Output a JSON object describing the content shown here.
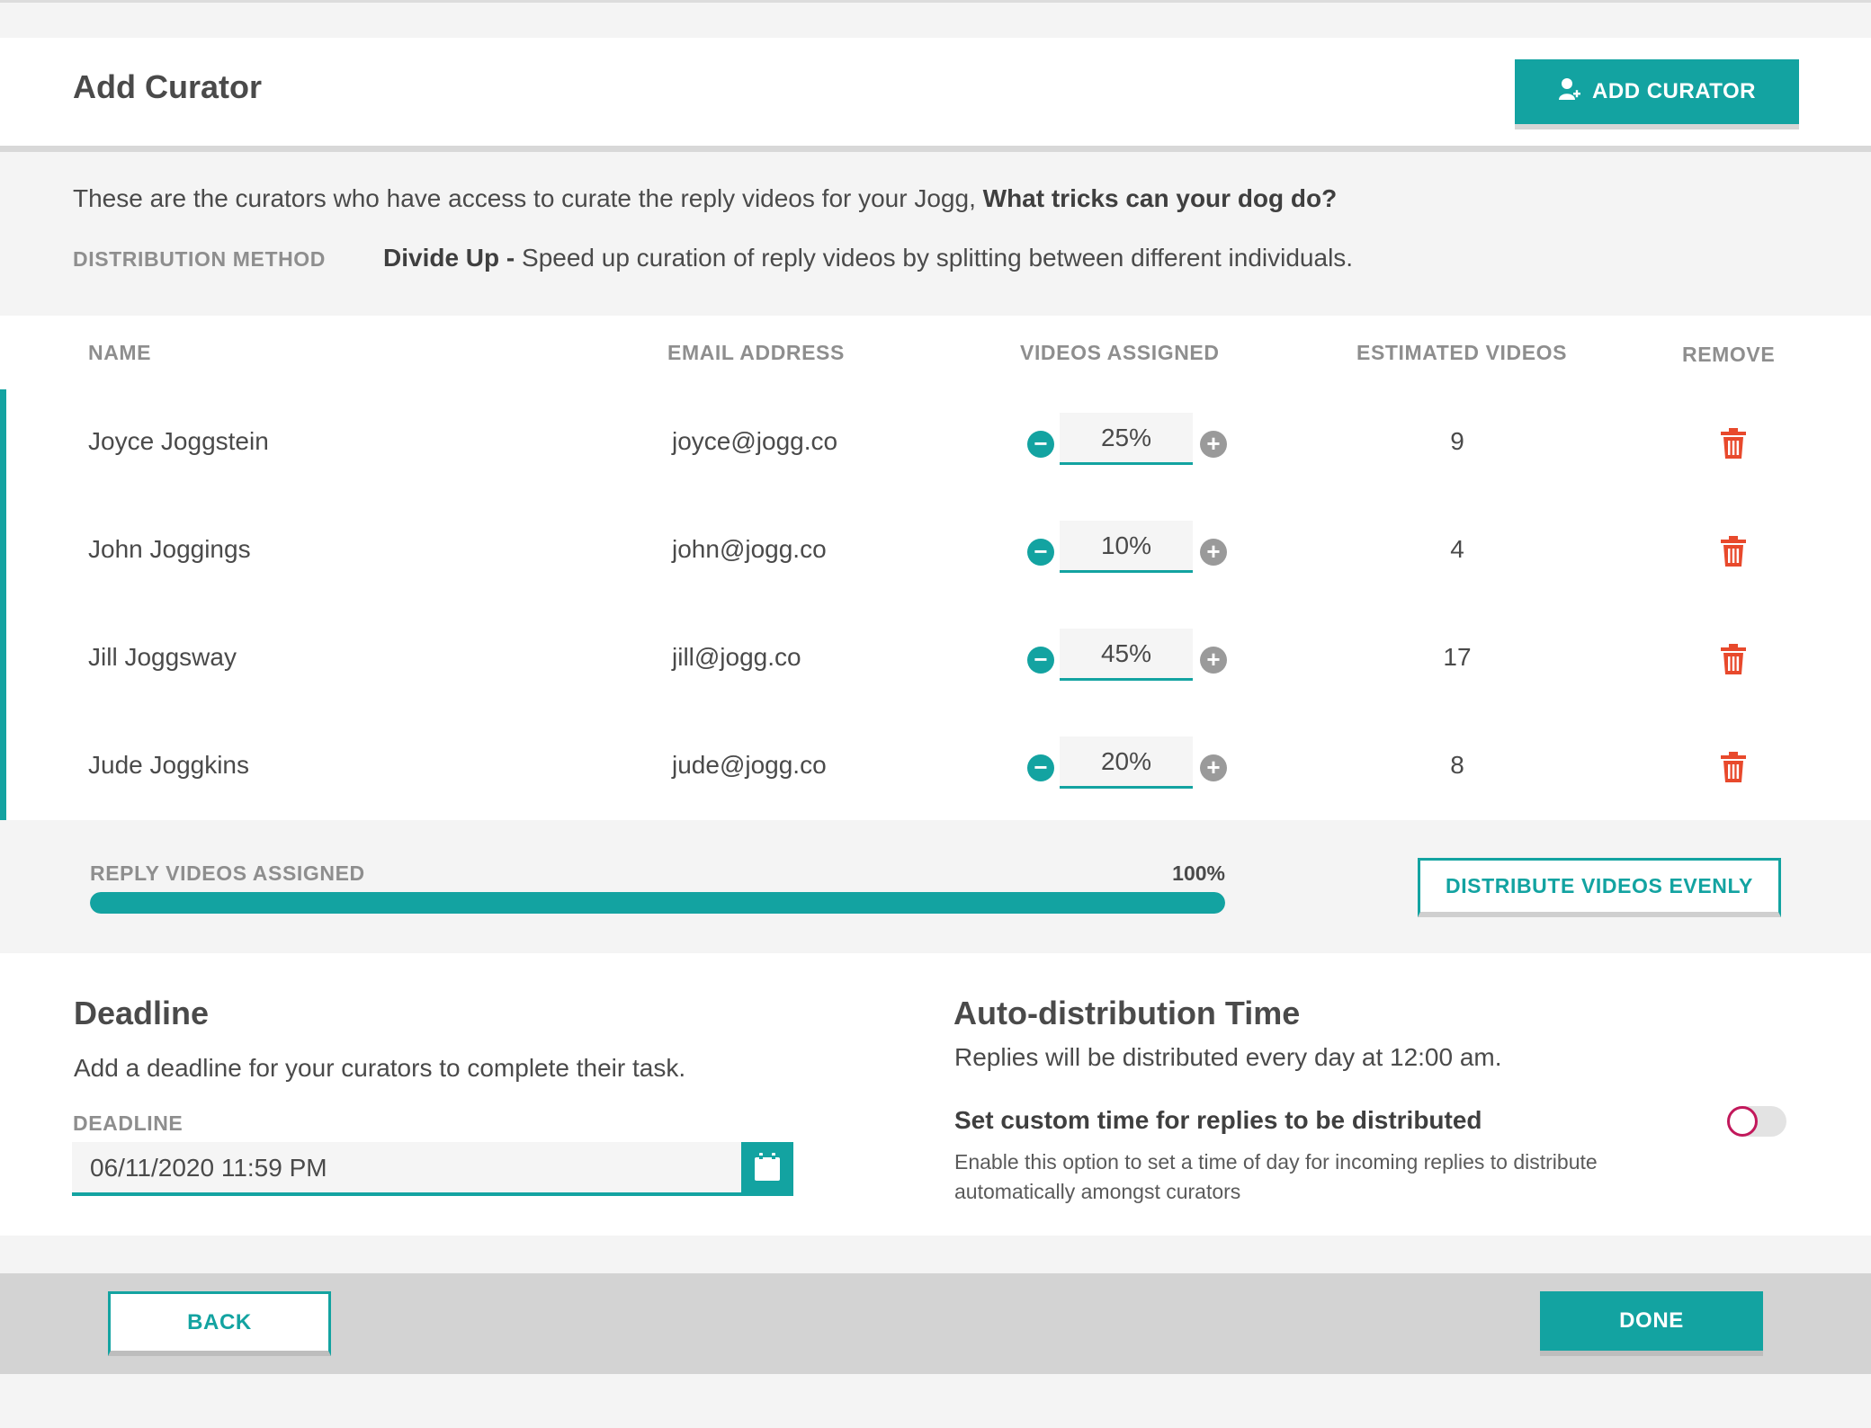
{
  "header": {
    "title": "Add Curator",
    "add_curator_label": "ADD CURATOR",
    "add_curator_icon": "add-user-icon"
  },
  "info": {
    "intro_text": "These are the curators who have access to curate the reply videos for your Jogg, ",
    "jogg_title": "What tricks can your dog do?",
    "distribution_method_label": "DISTRIBUTION METHOD",
    "distribution_method_name": "Divide Up -",
    "distribution_method_desc": " Speed up curation of reply videos by splitting between different individuals."
  },
  "table": {
    "headers": {
      "name": "NAME",
      "email": "EMAIL ADDRESS",
      "videos_assigned": "VIDEOS ASSIGNED",
      "estimated_videos": "ESTIMATED VIDEOS",
      "remove": "REMOVE"
    },
    "rows": [
      {
        "name": "Joyce Joggstein",
        "email": "joyce@jogg.co",
        "percent": "25%",
        "estimated": "9"
      },
      {
        "name": "John Joggings",
        "email": "john@jogg.co",
        "percent": "10%",
        "estimated": "4"
      },
      {
        "name": "Jill Joggsway",
        "email": "jill@jogg.co",
        "percent": "45%",
        "estimated": "17"
      },
      {
        "name": "Jude Joggkins",
        "email": "jude@jogg.co",
        "percent": "20%",
        "estimated": "8"
      }
    ]
  },
  "assigned": {
    "label": "REPLY VIDEOS ASSIGNED",
    "percent_text": "100%",
    "progress_fraction": 1.0,
    "distribute_label": "DISTRIBUTE VIDEOS EVENLY"
  },
  "deadline": {
    "title": "Deadline",
    "description": "Add a deadline for your curators to complete their task.",
    "field_label": "DEADLINE",
    "value": "06/11/2020 11:59 PM",
    "icon": "calendar-icon"
  },
  "auto_distribution": {
    "title": "Auto-distribution Time",
    "description": "Replies will be distributed every day at 12:00 am.",
    "custom_title": "Set custom time for replies to be distributed",
    "custom_desc": "Enable this option to set a time of day for incoming replies to distribute automatically amongst curators",
    "toggle_on": false
  },
  "footer": {
    "back_label": "BACK",
    "done_label": "DONE"
  },
  "colors": {
    "accent": "#13a3a1",
    "danger": "#e8492c",
    "toggle_ring": "#c2185b"
  }
}
